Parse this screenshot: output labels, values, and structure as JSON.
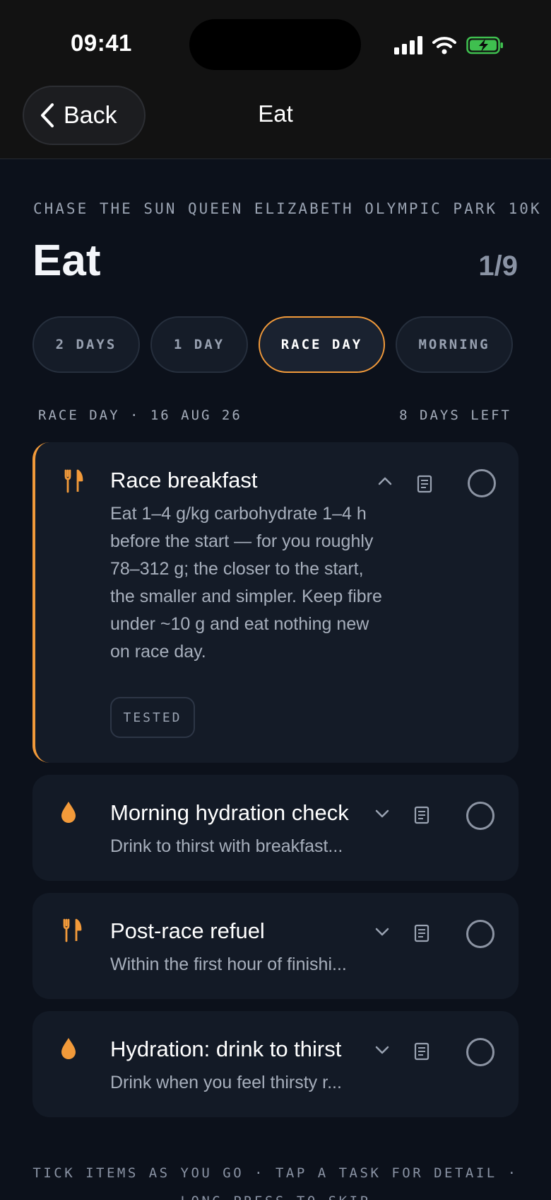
{
  "status_bar": {
    "time": "09:41"
  },
  "nav": {
    "back_label": "Back",
    "title": "Eat"
  },
  "header": {
    "event_name": "CHASE THE SUN QUEEN ELIZABETH OLYMPIC PARK 10K",
    "title": "Eat",
    "progress": "1/9"
  },
  "tabs": [
    {
      "label": "2 DAYS",
      "active": false
    },
    {
      "label": "1 DAY",
      "active": false
    },
    {
      "label": "RACE DAY",
      "active": true
    },
    {
      "label": "MORNING",
      "active": false
    }
  ],
  "section": {
    "date_label": "RACE DAY · 16 AUG 26",
    "days_left": "8 DAYS LEFT"
  },
  "tasks": [
    {
      "icon": "fork-knife-icon",
      "title": "Race breakfast",
      "description": "Eat 1–4 g/kg carbohydrate 1–4 h before the start — for you roughly 78–312 g; the closer to the start, the smaller and simpler. Keep fibre under ~10 g and eat nothing new on race day.",
      "tag": "TESTED",
      "expanded": true,
      "done": false
    },
    {
      "icon": "droplet-icon",
      "title": "Morning hydration check",
      "description": "Drink to thirst with breakfast...",
      "expanded": false,
      "done": false
    },
    {
      "icon": "fork-knife-icon",
      "title": "Post-race refuel",
      "description": "Within the first hour of finishi...",
      "expanded": false,
      "done": false
    },
    {
      "icon": "droplet-icon",
      "title": "Hydration: drink to thirst",
      "description": "Drink when you feel thirsty r...",
      "expanded": false,
      "done": false
    }
  ],
  "footer": {
    "hint_line1": "TICK ITEMS AS YOU GO · TAP A TASK FOR DETAIL ·",
    "hint_line2": "LONG PRESS TO SKIP"
  },
  "colors": {
    "accent": "#f29a3a",
    "background": "#0c111b",
    "card": "#131a26"
  }
}
